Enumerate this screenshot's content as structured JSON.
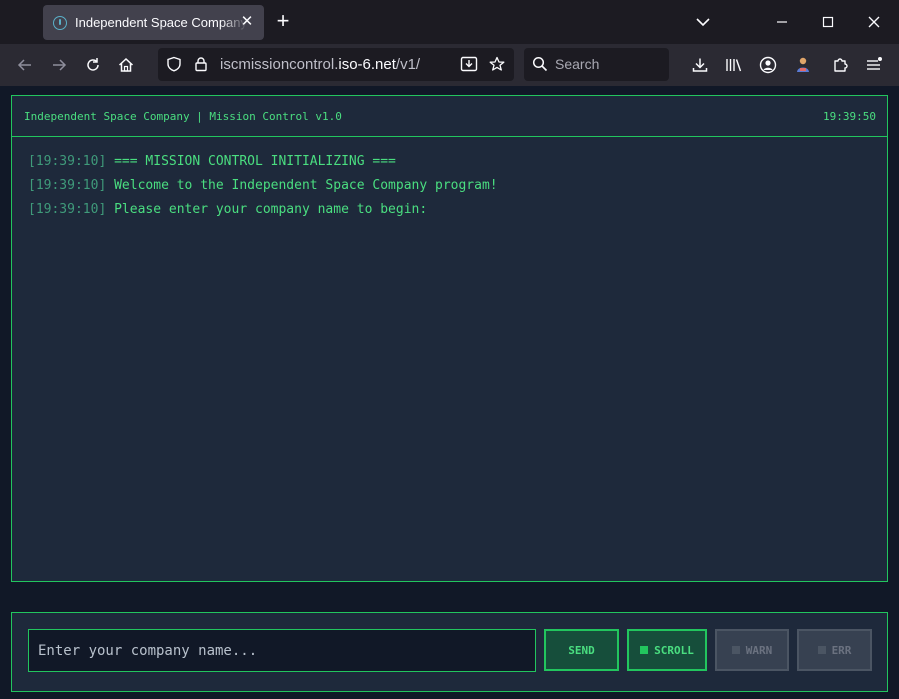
{
  "browser": {
    "tab_title": "Independent Space Company: Mission Control",
    "url_prefix": "iscmissioncontrol.",
    "url_host": "iso-6.net",
    "url_path": "/v1/",
    "search_placeholder": "Search"
  },
  "app": {
    "header_title": "Independent Space Company | Mission Control v1.0",
    "clock": "19:39:50",
    "log": [
      {
        "time": "[19:39:10]",
        "text": "=== MISSION CONTROL INITIALIZING ==="
      },
      {
        "time": "[19:39:10]",
        "text": "Welcome to the Independent Space Company program!"
      },
      {
        "time": "[19:39:10]",
        "text": "Please enter your company name to begin:"
      }
    ],
    "input_placeholder": "Enter your company name...",
    "buttons": {
      "send": "SEND",
      "scroll": "SCROLL",
      "warn": "WARN",
      "err": "ERR"
    }
  },
  "colors": {
    "accent": "#22c55e",
    "text_green": "#4ade80",
    "panel_bg": "#1e293b",
    "page_bg": "#111827"
  }
}
